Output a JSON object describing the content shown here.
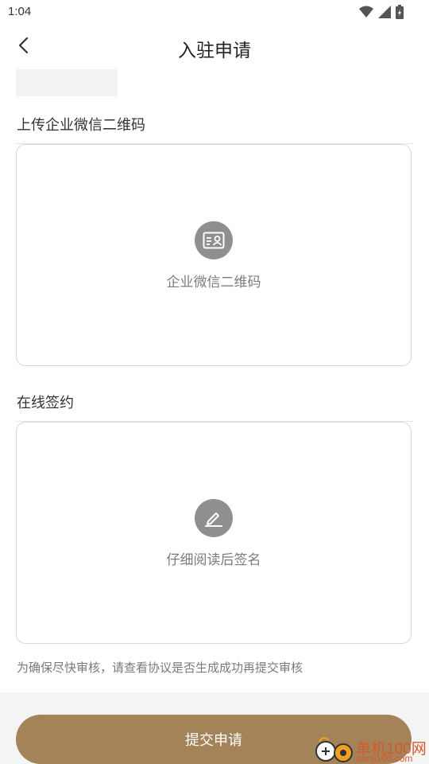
{
  "status_bar": {
    "time": "1:04"
  },
  "nav": {
    "title": "入驻申请"
  },
  "qrcode_section": {
    "label": "上传企业微信二维码",
    "upload_text": "企业微信二维码"
  },
  "sign_section": {
    "label": "在线签约",
    "upload_text": "仔细阅读后签名"
  },
  "notice": "为确保尽快审核，请查看协议是否生成成功再提交审核",
  "submit_label": "提交申请",
  "watermark": {
    "cn": "单机100网",
    "en": "danji100.com"
  },
  "colors": {
    "accent": "#a48358",
    "icon_circle": "#8f8f8f",
    "watermark": "#d8572b"
  },
  "icons": [
    "wifi-icon",
    "signal-icon",
    "battery-icon",
    "back-arrow-icon",
    "id-card-icon",
    "pen-icon"
  ]
}
